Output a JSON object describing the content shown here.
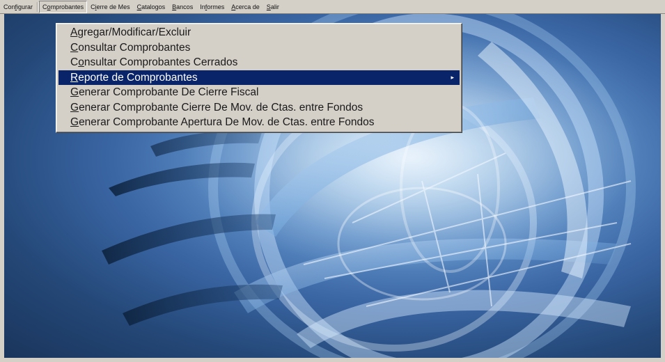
{
  "menubar": {
    "items": [
      {
        "pre": "Con",
        "u": "f",
        "post": "igurar"
      },
      {
        "pre": "C",
        "u": "o",
        "post": "mprobantes"
      },
      {
        "pre": "C",
        "u": "i",
        "post": "erre de Mes"
      },
      {
        "pre": "",
        "u": "C",
        "post": "atalogos"
      },
      {
        "pre": "",
        "u": "B",
        "post": "ancos"
      },
      {
        "pre": "In",
        "u": "f",
        "post": "ormes"
      },
      {
        "pre": "",
        "u": "A",
        "post": "cerca de"
      },
      {
        "pre": "",
        "u": "S",
        "post": "alir"
      }
    ]
  },
  "dropdown": {
    "items": [
      {
        "pre": "",
        "u": "A",
        "post": "gregar/Modificar/Excluir"
      },
      {
        "pre": "",
        "u": "C",
        "post": "onsultar Comprobantes"
      },
      {
        "pre": "C",
        "u": "o",
        "post": "nsultar Comprobantes Cerrados"
      },
      {
        "pre": "",
        "u": "R",
        "post": "eporte de Comprobantes"
      },
      {
        "pre": "",
        "u": "G",
        "post": "enerar Comprobante De Cierre Fiscal"
      },
      {
        "pre": "",
        "u": "G",
        "post": "enerar Comprobante Cierre De Mov. de Ctas. entre Fondos"
      },
      {
        "pre": "",
        "u": "G",
        "post": "enerar Comprobante Apertura De Mov. de Ctas. entre Fondos"
      }
    ],
    "highlighted_index": 3,
    "submenu_arrow": "▸"
  },
  "colors": {
    "highlight": "#0a246a",
    "menu_bg": "#d4d0c8"
  }
}
